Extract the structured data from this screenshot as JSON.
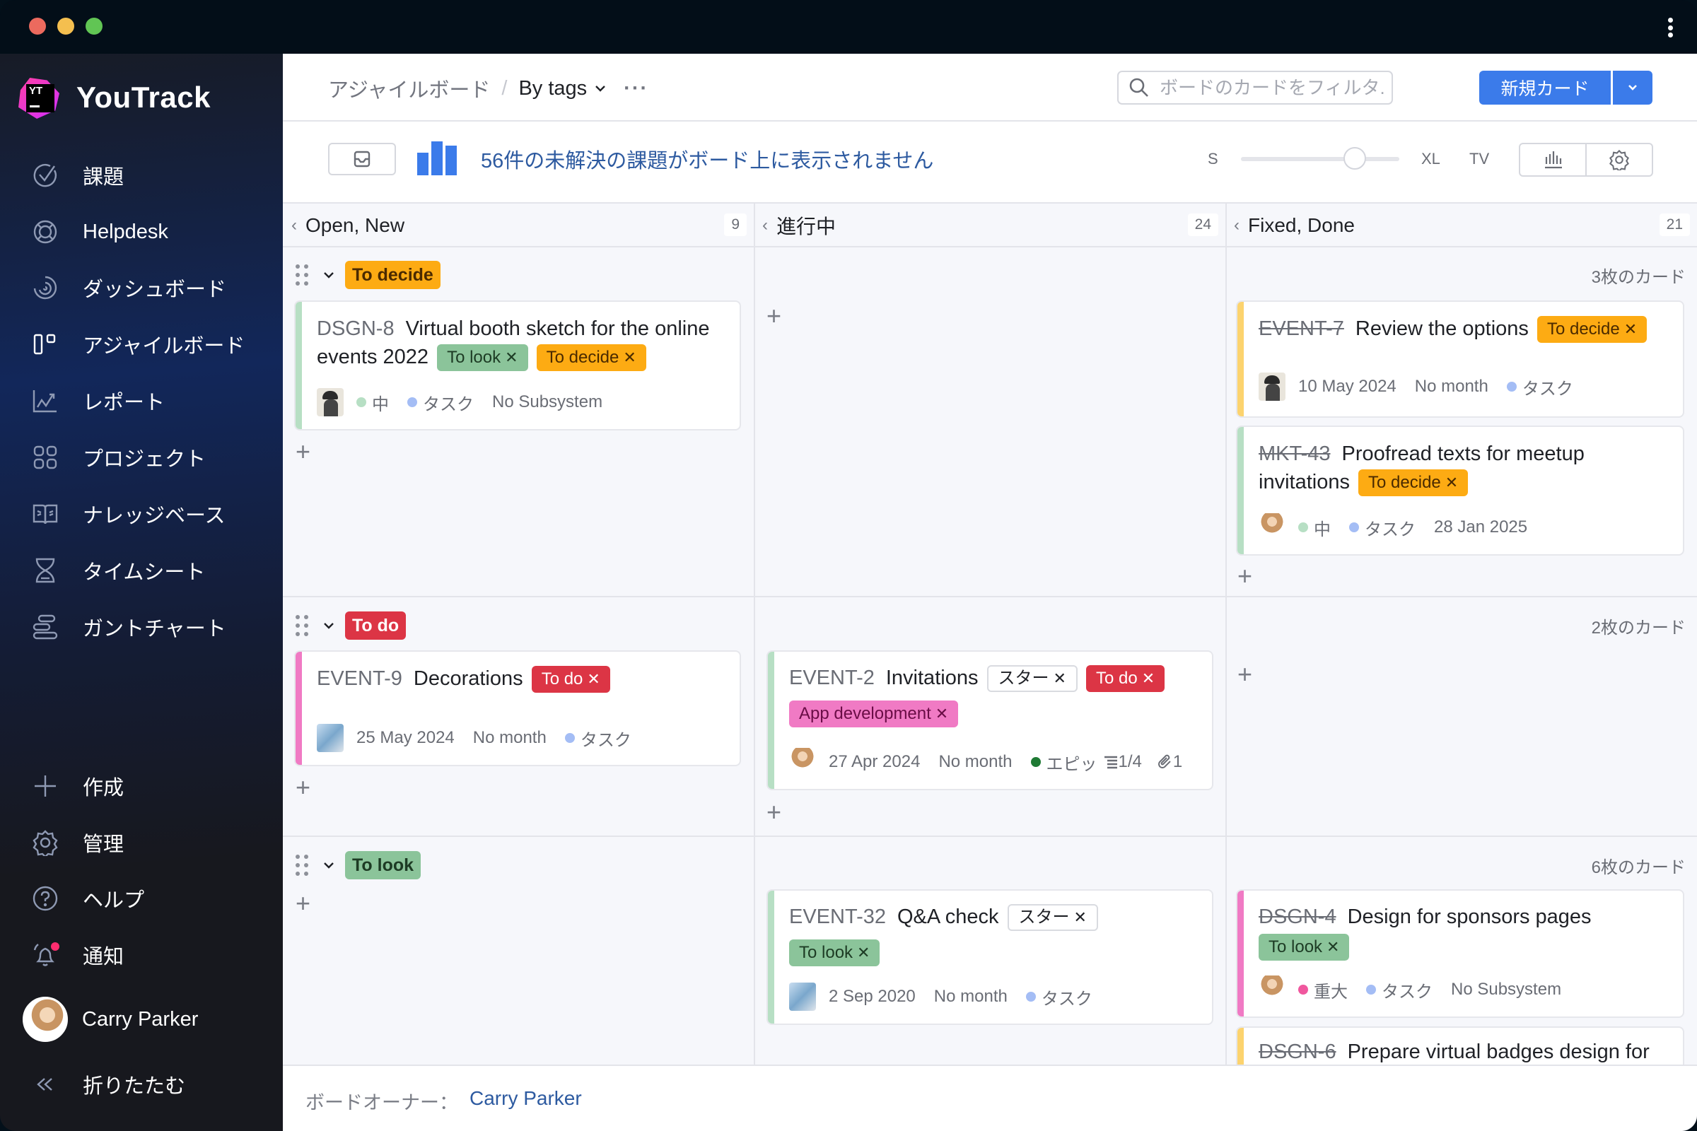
{
  "window": {
    "title_menu_icon": "kebab-vertical-icon"
  },
  "sidebar": {
    "logo_text": "YouTrack",
    "logo_mark": "YT",
    "items": [
      {
        "label": "課題",
        "icon": "check-circle-icon"
      },
      {
        "label": "Helpdesk",
        "icon": "lifebuoy-icon"
      },
      {
        "label": "ダッシュボード",
        "icon": "dashboard-icon"
      },
      {
        "label": "アジャイルボード",
        "icon": "agile-board-icon"
      },
      {
        "label": "レポート",
        "icon": "report-chart-icon"
      },
      {
        "label": "プロジェクト",
        "icon": "projects-grid-icon"
      },
      {
        "label": "ナレッジベース",
        "icon": "book-icon"
      },
      {
        "label": "タイムシート",
        "icon": "hourglass-icon"
      },
      {
        "label": "ガントチャート",
        "icon": "gantt-icon"
      }
    ],
    "bottom_items": [
      {
        "label": "作成",
        "icon": "plus-icon"
      },
      {
        "label": "管理",
        "icon": "gear-icon"
      },
      {
        "label": "ヘルプ",
        "icon": "help-icon"
      },
      {
        "label": "通知",
        "icon": "bell-icon"
      }
    ],
    "user_name": "Carry Parker",
    "collapse_label": "折りたたむ"
  },
  "header": {
    "breadcrumb_root": "アジャイルボード",
    "breadcrumb_separator": "/",
    "board_name": "By tags",
    "more": "···",
    "search_placeholder": "ボードのカードをフィルタ...",
    "new_card_label": "新規カード"
  },
  "toolbar": {
    "unresolved_message": "56件の未解決の課題がボード上に表示されません",
    "size_s": "S",
    "size_xl": "XL",
    "size_tv": "TV",
    "card_size_level": 0.72
  },
  "columns": [
    {
      "name": "Open, New",
      "count": "9"
    },
    {
      "name": "進行中",
      "count": "24"
    },
    {
      "name": "Fixed, Done",
      "count": "21"
    }
  ],
  "swimlanes": [
    {
      "tag": "To decide",
      "count_label": "3枚のカード"
    },
    {
      "tag": "To do",
      "count_label": "2枚のカード"
    },
    {
      "tag": "To look",
      "count_label": "6枚のカード"
    }
  ],
  "cards": {
    "dsgn8": {
      "id": "DSGN-8",
      "summary": "Virtual booth sketch for the online events 2022",
      "tags": [
        "To look",
        "To decide"
      ],
      "priority": "中",
      "type": "タスク",
      "subsystem": "No Subsystem"
    },
    "event7": {
      "id": "EVENT-7",
      "summary": "Review the options",
      "tags": [
        "To decide"
      ],
      "date": "10 May 2024",
      "month": "No month",
      "type": "タスク"
    },
    "mkt43": {
      "id": "MKT-43",
      "summary": "Proofread texts for meetup invitations",
      "tags": [
        "To decide"
      ],
      "priority": "中",
      "type": "タスク",
      "date": "28 Jan 2025"
    },
    "event9": {
      "id": "EVENT-9",
      "summary": "Decorations",
      "tags": [
        "To do"
      ],
      "date": "25 May 2024",
      "month": "No month",
      "type": "タスク"
    },
    "event2": {
      "id": "EVENT-2",
      "summary": "Invitations",
      "tags": [
        "スター",
        "To do",
        "App development"
      ],
      "date": "27 Apr 2024",
      "month": "No month",
      "type": "エピッ",
      "subtasks": "1/4",
      "attachments": "1"
    },
    "event32": {
      "id": "EVENT-32",
      "summary": "Q&A check",
      "tags": [
        "スター",
        "To look"
      ],
      "date": "2 Sep 2020",
      "month": "No month",
      "type": "タスク"
    },
    "dsgn4": {
      "id": "DSGN-4",
      "summary": "Design for sponsors pages",
      "tags": [
        "To look"
      ],
      "priority": "重大",
      "type": "タスク",
      "subsystem": "No Subsystem"
    },
    "dsgn6": {
      "id": "DSGN-6",
      "summary": "Prepare virtual badges design for"
    }
  },
  "tag_close": "✕",
  "footer": {
    "owner_label": "ボードオーナー：",
    "owner_name": "Carry Parker"
  },
  "colors": {
    "accent": "#3b7bea",
    "to_decide": "#fdab13",
    "to_do": "#dc3545",
    "to_look": "#8bc49a",
    "app_development": "#f07ac4",
    "priority_normal": "#b7dfc4",
    "priority_critical": "#f0579e",
    "type_task": "#a4bdf5",
    "type_epic": "#1f7a34"
  }
}
